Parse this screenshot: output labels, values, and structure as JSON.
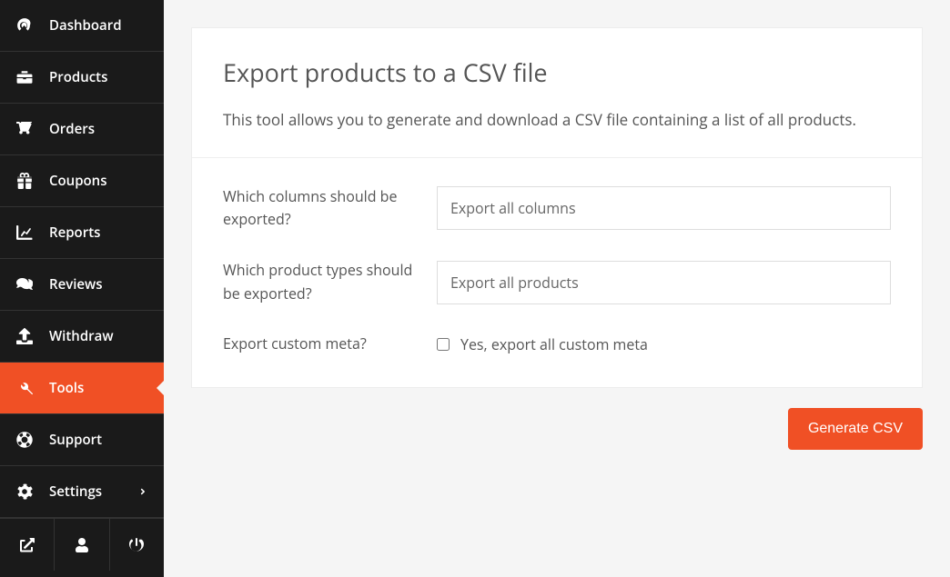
{
  "sidebar": {
    "items": [
      {
        "label": "Dashboard",
        "icon": "dashboard-icon",
        "active": false
      },
      {
        "label": "Products",
        "icon": "briefcase-icon",
        "active": false
      },
      {
        "label": "Orders",
        "icon": "cart-icon",
        "active": false
      },
      {
        "label": "Coupons",
        "icon": "gift-icon",
        "active": false
      },
      {
        "label": "Reports",
        "icon": "chart-icon",
        "active": false
      },
      {
        "label": "Reviews",
        "icon": "comments-icon",
        "active": false
      },
      {
        "label": "Withdraw",
        "icon": "upload-icon",
        "active": false
      },
      {
        "label": "Tools",
        "icon": "wrench-icon",
        "active": true
      },
      {
        "label": "Support",
        "icon": "life-ring-icon",
        "active": false
      },
      {
        "label": "Settings",
        "icon": "gear-icon",
        "active": false,
        "has_submenu": true
      }
    ],
    "bottom": [
      {
        "icon": "external-link-icon"
      },
      {
        "icon": "user-icon"
      },
      {
        "icon": "power-icon"
      }
    ]
  },
  "main": {
    "title": "Export products to a CSV file",
    "description": "This tool allows you to generate and download a CSV file containing a list of all products.",
    "fields": {
      "columns_label": "Which columns should be exported?",
      "columns_value": "Export all columns",
      "types_label": "Which product types should be exported?",
      "types_value": "Export all products",
      "meta_label": "Export custom meta?",
      "meta_check_label": "Yes, export all custom meta",
      "meta_checked": false
    },
    "button_label": "Generate CSV"
  },
  "colors": {
    "accent": "#f05025"
  }
}
